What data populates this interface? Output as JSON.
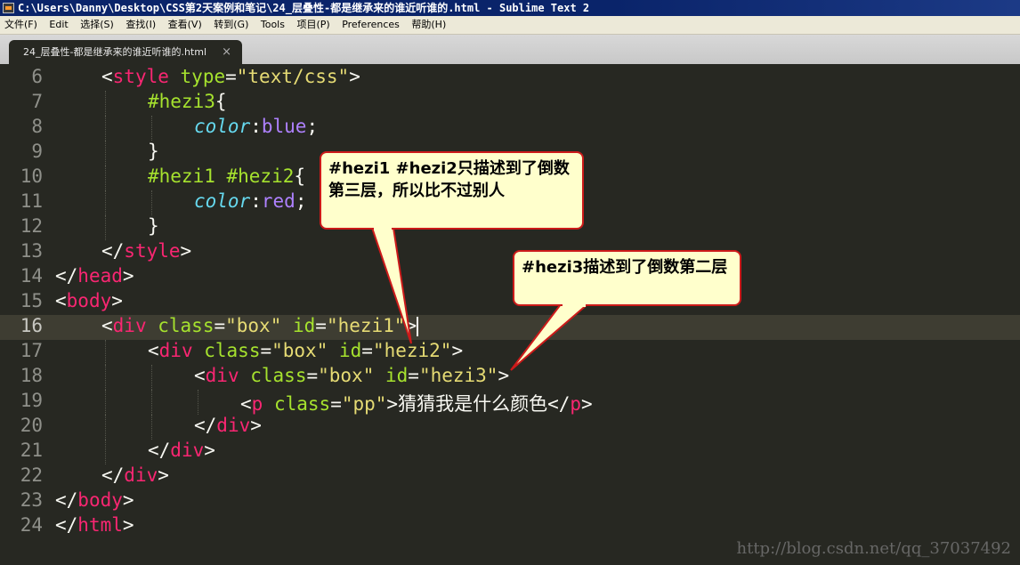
{
  "window": {
    "title": "C:\\Users\\Danny\\Desktop\\CSS第2天案例和笔记\\24_层叠性-都是继承来的谁近听谁的.html - Sublime Text 2"
  },
  "menu": [
    {
      "label": "文件(F)"
    },
    {
      "label": "Edit"
    },
    {
      "label": "选择(S)"
    },
    {
      "label": "查找(I)"
    },
    {
      "label": "查看(V)"
    },
    {
      "label": "转到(G)"
    },
    {
      "label": "Tools"
    },
    {
      "label": "项目(P)"
    },
    {
      "label": "Preferences"
    },
    {
      "label": "帮助(H)"
    }
  ],
  "tab": {
    "label": "24_层叠性-都是继承来的谁近听谁的.html",
    "close": "×"
  },
  "editor": {
    "current_line": 16,
    "lines": [
      {
        "num": "6",
        "indent": 1,
        "tokens": [
          [
            "pun",
            "<"
          ],
          [
            "tag",
            "style"
          ],
          [
            "pun",
            " "
          ],
          [
            "attr",
            "type"
          ],
          [
            "pun",
            "="
          ],
          [
            "str",
            "\"text/css\""
          ],
          [
            "pun",
            ">"
          ]
        ]
      },
      {
        "num": "7",
        "indent": 2,
        "tokens": [
          [
            "sel",
            "#hezi3"
          ],
          [
            "pun",
            "{"
          ]
        ]
      },
      {
        "num": "8",
        "indent": 3,
        "tokens": [
          [
            "prop",
            "color"
          ],
          [
            "pun",
            ":"
          ],
          [
            "val",
            "blue"
          ],
          [
            "pun",
            ";"
          ]
        ]
      },
      {
        "num": "9",
        "indent": 2,
        "tokens": [
          [
            "pun",
            "}"
          ]
        ]
      },
      {
        "num": "10",
        "indent": 2,
        "tokens": [
          [
            "sel",
            "#hezi1 #hezi2"
          ],
          [
            "pun",
            "{"
          ]
        ]
      },
      {
        "num": "11",
        "indent": 3,
        "tokens": [
          [
            "prop",
            "color"
          ],
          [
            "pun",
            ":"
          ],
          [
            "val",
            "red"
          ],
          [
            "pun",
            ";"
          ]
        ]
      },
      {
        "num": "12",
        "indent": 2,
        "tokens": [
          [
            "pun",
            "}"
          ]
        ]
      },
      {
        "num": "13",
        "indent": 1,
        "tokens": [
          [
            "pun",
            "</"
          ],
          [
            "tag",
            "style"
          ],
          [
            "pun",
            ">"
          ]
        ]
      },
      {
        "num": "14",
        "indent": 0,
        "tokens": [
          [
            "pun",
            "</"
          ],
          [
            "tag",
            "head"
          ],
          [
            "pun",
            ">"
          ]
        ]
      },
      {
        "num": "15",
        "indent": 0,
        "tokens": [
          [
            "pun",
            "<"
          ],
          [
            "tag",
            "body"
          ],
          [
            "pun",
            ">"
          ]
        ]
      },
      {
        "num": "16",
        "indent": 1,
        "tokens": [
          [
            "pun",
            "<"
          ],
          [
            "tag",
            "div"
          ],
          [
            "pun",
            " "
          ],
          [
            "attr",
            "class"
          ],
          [
            "pun",
            "="
          ],
          [
            "str",
            "\"box\""
          ],
          [
            "pun",
            " "
          ],
          [
            "attr",
            "id"
          ],
          [
            "pun",
            "="
          ],
          [
            "str",
            "\"hezi1\""
          ],
          [
            "pun",
            ">"
          ]
        ]
      },
      {
        "num": "17",
        "indent": 2,
        "tokens": [
          [
            "pun",
            "<"
          ],
          [
            "tag",
            "div"
          ],
          [
            "pun",
            " "
          ],
          [
            "attr",
            "class"
          ],
          [
            "pun",
            "="
          ],
          [
            "str",
            "\"box\""
          ],
          [
            "pun",
            " "
          ],
          [
            "attr",
            "id"
          ],
          [
            "pun",
            "="
          ],
          [
            "str",
            "\"hezi2\""
          ],
          [
            "pun",
            ">"
          ]
        ]
      },
      {
        "num": "18",
        "indent": 3,
        "tokens": [
          [
            "pun",
            "<"
          ],
          [
            "tag",
            "div"
          ],
          [
            "pun",
            " "
          ],
          [
            "attr",
            "class"
          ],
          [
            "pun",
            "="
          ],
          [
            "str",
            "\"box\""
          ],
          [
            "pun",
            " "
          ],
          [
            "attr",
            "id"
          ],
          [
            "pun",
            "="
          ],
          [
            "str",
            "\"hezi3\""
          ],
          [
            "pun",
            ">"
          ]
        ]
      },
      {
        "num": "19",
        "indent": 4,
        "tokens": [
          [
            "pun",
            "<"
          ],
          [
            "tag",
            "p"
          ],
          [
            "pun",
            " "
          ],
          [
            "attr",
            "class"
          ],
          [
            "pun",
            "="
          ],
          [
            "str",
            "\"pp\""
          ],
          [
            "pun",
            ">猜猜我是什么颜色</"
          ],
          [
            "tag",
            "p"
          ],
          [
            "pun",
            ">"
          ]
        ]
      },
      {
        "num": "20",
        "indent": 3,
        "tokens": [
          [
            "pun",
            "</"
          ],
          [
            "tag",
            "div"
          ],
          [
            "pun",
            ">"
          ]
        ]
      },
      {
        "num": "21",
        "indent": 2,
        "tokens": [
          [
            "pun",
            "</"
          ],
          [
            "tag",
            "div"
          ],
          [
            "pun",
            ">"
          ]
        ]
      },
      {
        "num": "22",
        "indent": 1,
        "tokens": [
          [
            "pun",
            "</"
          ],
          [
            "tag",
            "div"
          ],
          [
            "pun",
            ">"
          ]
        ]
      },
      {
        "num": "23",
        "indent": 0,
        "tokens": [
          [
            "pun",
            "</"
          ],
          [
            "tag",
            "body"
          ],
          [
            "pun",
            ">"
          ]
        ]
      },
      {
        "num": "24",
        "indent": 0,
        "tokens": [
          [
            "pun",
            "</"
          ],
          [
            "tag",
            "html"
          ],
          [
            "pun",
            ">"
          ]
        ]
      }
    ]
  },
  "callouts": {
    "first": "#hezi1 #hezi2只描述到了倒数第三层，所以比不过别人",
    "second": "#hezi3描述到了倒数第二层"
  },
  "watermark": "http://blog.csdn.net/qq_37037492",
  "colors": {
    "background": "#272822",
    "callout_fill": "#ffffcc",
    "callout_border": "#cc1a1a"
  }
}
